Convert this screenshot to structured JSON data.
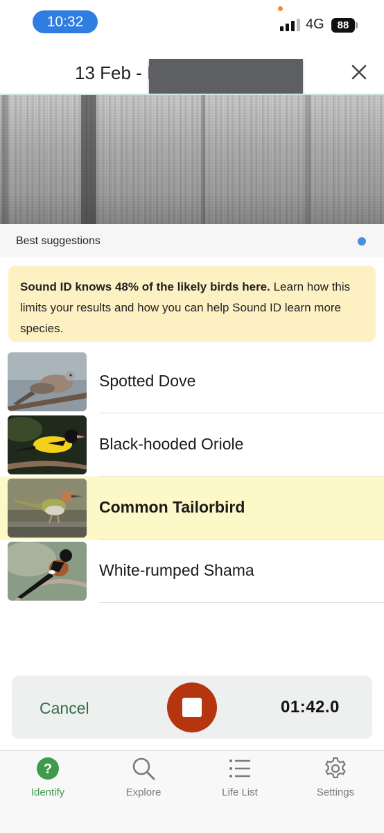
{
  "status_bar": {
    "time": "10:32",
    "network": "4G",
    "battery": "88"
  },
  "header": {
    "title": "13 Feb - I",
    "close_icon": "close-icon"
  },
  "suggestions": {
    "label": "Best suggestions"
  },
  "notice": {
    "bold_text": "Sound ID knows 48% of the likely birds here.",
    "text": " Learn how this limits your results and how you can help Sound ID learn more species."
  },
  "results": [
    {
      "name": "Spotted Dove",
      "highlighted": false
    },
    {
      "name": "Black-hooded Oriole",
      "highlighted": false
    },
    {
      "name": "Common Tailorbird",
      "highlighted": true
    },
    {
      "name": "White-rumped Shama",
      "highlighted": false
    }
  ],
  "recording": {
    "cancel_label": "Cancel",
    "timer": "01:42.0"
  },
  "tabs": [
    {
      "label": "Identify",
      "icon": "question-icon",
      "active": true
    },
    {
      "label": "Explore",
      "icon": "search-icon",
      "active": false
    },
    {
      "label": "Life List",
      "icon": "list-icon",
      "active": false
    },
    {
      "label": "Settings",
      "icon": "gear-icon",
      "active": false
    }
  ],
  "colors": {
    "accent_green": "#3f9b4c",
    "stop_red": "#b5350f",
    "highlight": "#fdf8c8",
    "notice_bg": "#fdf1c4"
  }
}
